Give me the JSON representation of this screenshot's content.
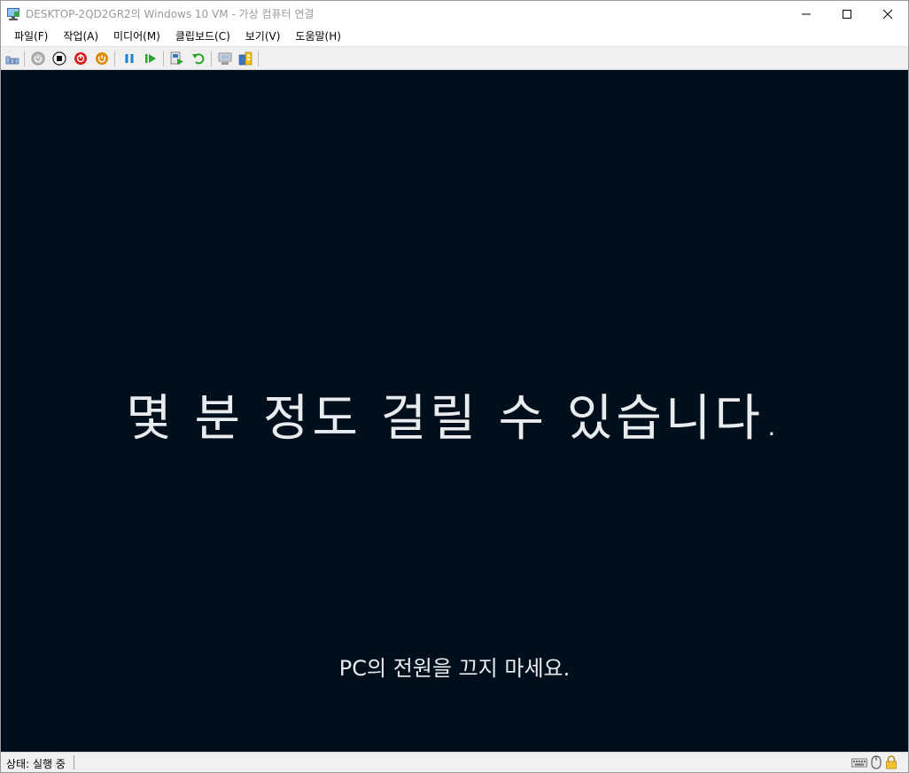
{
  "window": {
    "title": "DESKTOP-2QD2GR2의 Windows 10 VM - 가상 컴퓨터 연결",
    "controls": [
      "minimize-icon",
      "maximize-icon",
      "close-icon"
    ]
  },
  "menu": {
    "items": [
      {
        "label": "파일(F)"
      },
      {
        "label": "작업(A)"
      },
      {
        "label": "미디어(M)"
      },
      {
        "label": "클립보드(C)"
      },
      {
        "label": "보기(V)"
      },
      {
        "label": "도움말(H)"
      }
    ]
  },
  "toolbar": {
    "buttons": [
      "ctrl-alt-del-icon",
      "start-icon",
      "turn-off-icon",
      "shut-down-icon",
      "save-icon",
      "pause-icon",
      "resume-icon",
      "checkpoint-icon",
      "revert-icon",
      "enhanced-session-icon",
      "share-icon"
    ]
  },
  "vm": {
    "main_message": "몇 분 정도 걸릴 수 있습니다.",
    "sub_message": "PC의 전원을 끄지 마세요.",
    "background": "#010e1b"
  },
  "status": {
    "text": "상태: 실행 중",
    "icons": [
      "keyboard-icon",
      "mouse-icon",
      "lock-icon"
    ]
  },
  "colors": {
    "accent_red": "#d81e1e",
    "accent_orange": "#e08a00",
    "accent_blue": "#1b7fd6",
    "accent_green": "#2aa52a"
  }
}
